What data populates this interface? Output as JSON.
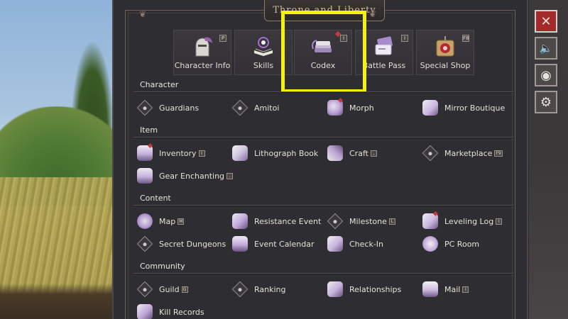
{
  "window": {
    "title": "Throne and Liberty"
  },
  "tabs": [
    {
      "label": "Character Info",
      "key": "P"
    },
    {
      "label": "Skills",
      "key": ""
    },
    {
      "label": "Codex",
      "key": "I"
    },
    {
      "label": "Battle Pass",
      "key": "I"
    },
    {
      "label": "Special Shop",
      "key": "F8"
    }
  ],
  "sections": {
    "character": {
      "title": "Character",
      "items": [
        {
          "label": "Guardians",
          "key": ""
        },
        {
          "label": "Amitoi",
          "key": ""
        },
        {
          "label": "Morph",
          "key": ""
        },
        {
          "label": "Mirror Boutique",
          "key": ""
        }
      ]
    },
    "item": {
      "title": "Item",
      "items": [
        {
          "label": "Inventory",
          "key": "I"
        },
        {
          "label": "Lithograph Book",
          "key": ""
        },
        {
          "label": "Craft",
          "key": ","
        },
        {
          "label": "Marketplace",
          "key": "F9"
        },
        {
          "label": "Gear Enchanting",
          "key": "."
        }
      ]
    },
    "content": {
      "title": "Content",
      "items": [
        {
          "label": "Map",
          "key": "M"
        },
        {
          "label": "Resistance Event",
          "key": ""
        },
        {
          "label": "Milestone",
          "key": "L"
        },
        {
          "label": "Leveling Log",
          "key": "I"
        },
        {
          "label": "Secret Dungeons",
          "key": ""
        },
        {
          "label": "Event Calendar",
          "key": ""
        },
        {
          "label": "Check-In",
          "key": ""
        },
        {
          "label": "PC Room",
          "key": ""
        }
      ]
    },
    "community": {
      "title": "Community",
      "items": [
        {
          "label": "Guild",
          "key": "G"
        },
        {
          "label": "Ranking",
          "key": ""
        },
        {
          "label": "Relationships",
          "key": ""
        },
        {
          "label": "Mail",
          "key": "I"
        },
        {
          "label": "Kill Records",
          "key": ""
        }
      ]
    }
  },
  "side_buttons": [
    {
      "icon": "close-icon",
      "glyph": "✕"
    },
    {
      "icon": "speaker-icon",
      "glyph": "🔈"
    },
    {
      "icon": "stamp-icon",
      "glyph": "◉"
    },
    {
      "icon": "user-settings-icon",
      "glyph": "⚙"
    }
  ],
  "colors": {
    "highlight": "#f4f20a",
    "accent_red": "#c23a3f",
    "panel": "#2e2d31"
  }
}
